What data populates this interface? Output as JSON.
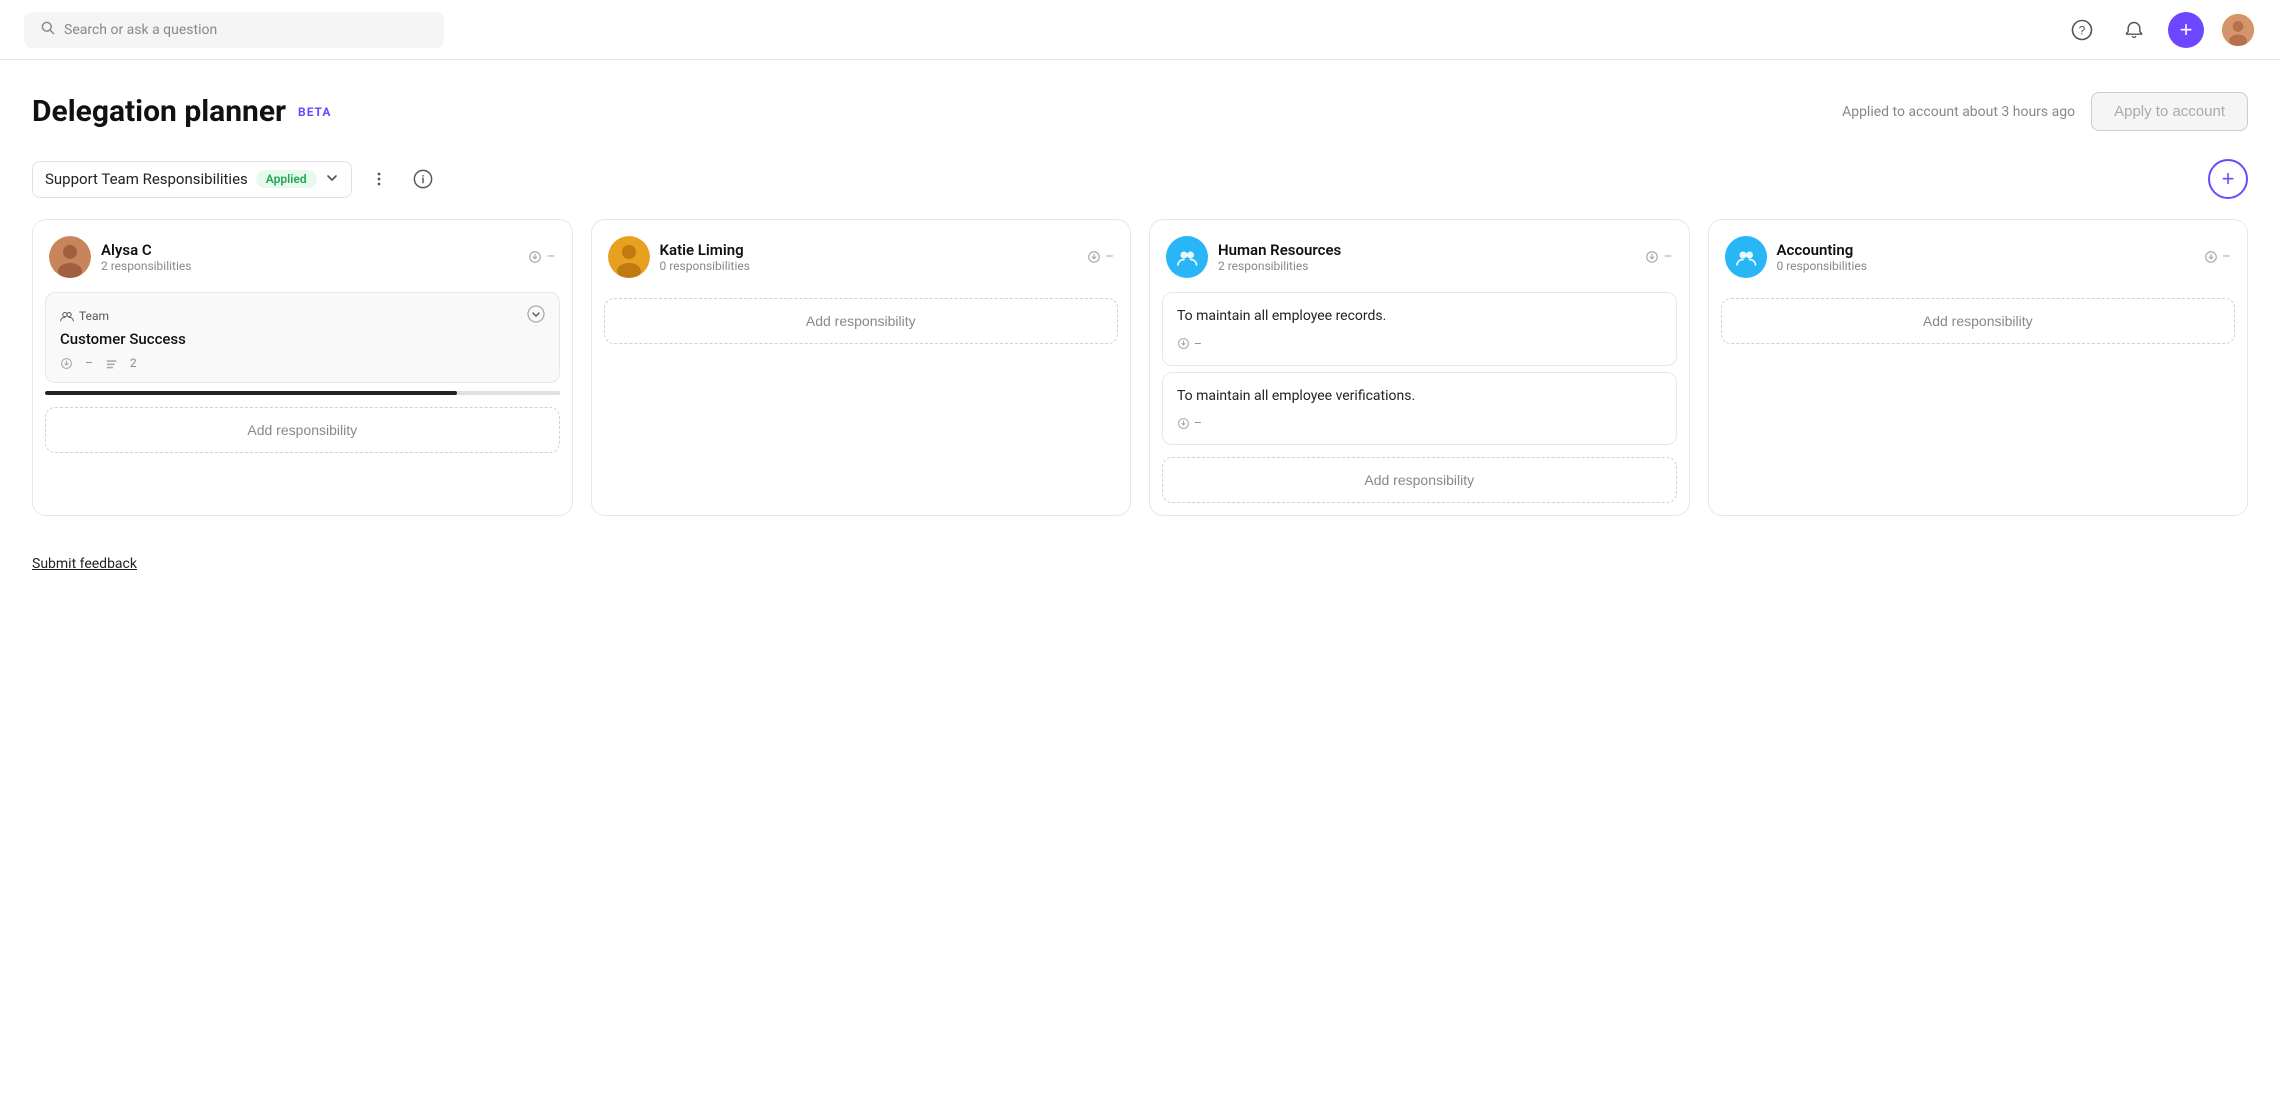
{
  "nav": {
    "search_placeholder": "Search or ask a question",
    "add_btn_label": "+",
    "avatar_label": "User Avatar"
  },
  "page": {
    "title": "Delegation planner",
    "beta": "BETA",
    "applied_text": "Applied to account about 3 hours ago",
    "apply_btn": "Apply to account"
  },
  "toolbar": {
    "plan_name": "Support Team Responsibilities",
    "applied_badge": "Applied",
    "more_options_label": "More options",
    "info_label": "Info",
    "add_plan_label": "Add plan"
  },
  "cards": [
    {
      "id": "alysa",
      "name": "Alysa C",
      "resp_count": "2 responsibilities",
      "avatar_type": "image",
      "avatar_color": "#d4956a",
      "responsibilities": [
        {
          "type": "team",
          "team_label": "Team",
          "team_name": "Customer Success",
          "clock": "–",
          "count": "2",
          "progress": 80
        }
      ],
      "add_label": "Add responsibility"
    },
    {
      "id": "katie",
      "name": "Katie Liming",
      "resp_count": "0 responsibilities",
      "avatar_type": "image",
      "avatar_color": "#e8a020",
      "responsibilities": [],
      "add_label": "Add responsibility"
    },
    {
      "id": "human-resources",
      "name": "Human Resources",
      "resp_count": "2 responsibilities",
      "avatar_type": "group",
      "avatar_color": "#29b6f6",
      "responsibilities": [
        {
          "type": "text",
          "content": "To maintain all employee records.",
          "clock": "–"
        },
        {
          "type": "text",
          "content": "To maintain all employee verifications.",
          "clock": "–"
        }
      ],
      "add_label": "Add responsibility"
    },
    {
      "id": "accounting",
      "name": "Accounting",
      "resp_count": "0 responsibilities",
      "avatar_type": "group",
      "avatar_color": "#29b6f6",
      "responsibilities": [],
      "add_label": "Add responsibility"
    }
  ],
  "feedback": {
    "label": "Submit feedback"
  },
  "icons": {
    "search": "🔍",
    "help": "?",
    "bell": "🔔",
    "clock": "⏱",
    "list": "≡",
    "chevron_down": "⌄",
    "more": "⋮",
    "info": "ⓘ",
    "team": "👥",
    "chevron_right": "›"
  }
}
